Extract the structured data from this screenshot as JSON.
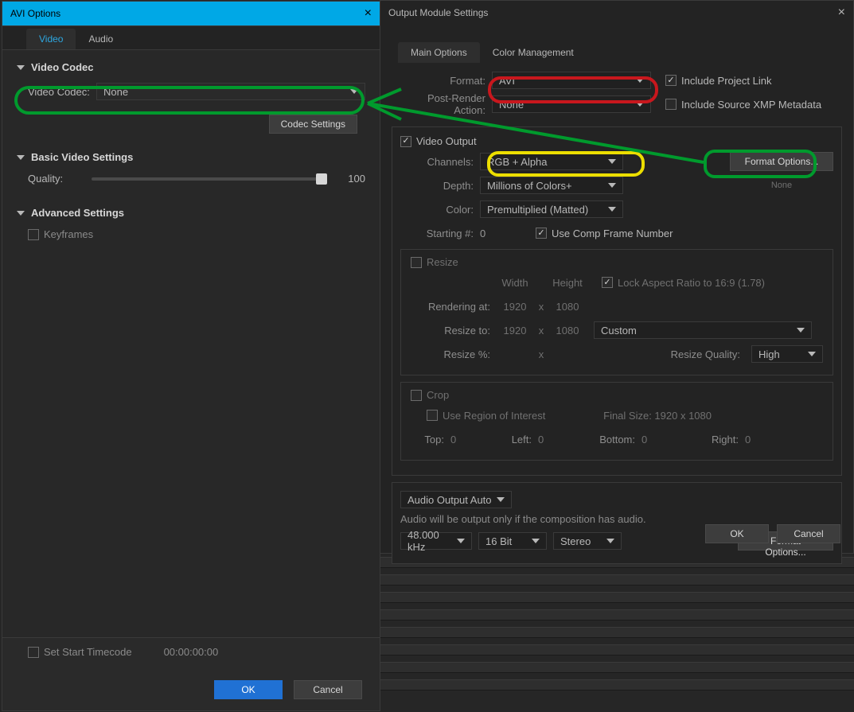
{
  "avi": {
    "title": "AVI Options",
    "tabs": {
      "video": "Video",
      "audio": "Audio"
    },
    "video_codec_header": "Video Codec",
    "video_codec_label": "Video Codec:",
    "video_codec_value": "None",
    "codec_settings_btn": "Codec Settings",
    "basic_header": "Basic Video Settings",
    "quality_label": "Quality:",
    "quality_value": "100",
    "advanced_header": "Advanced Settings",
    "keyframes_label": "Keyframes",
    "set_start_tc_label": "Set Start Timecode",
    "timecode_value": "00:00:00:00",
    "ok": "OK",
    "cancel": "Cancel"
  },
  "oms": {
    "title": "Output Module Settings",
    "tabs": {
      "main": "Main Options",
      "color": "Color Management"
    },
    "format_label": "Format:",
    "format_value": "AVI",
    "post_render_label": "Post-Render Action:",
    "post_render_value": "None",
    "include_project_link": "Include Project Link",
    "include_xmp": "Include Source XMP Metadata",
    "video_output_label": "Video Output",
    "channels_label": "Channels:",
    "channels_value": "RGB + Alpha",
    "format_options_btn": "Format Options...",
    "depth_label": "Depth:",
    "depth_value": "Millions of Colors+",
    "depth_note": "None",
    "color_label": "Color:",
    "color_value": "Premultiplied (Matted)",
    "starting_label": "Starting #:",
    "starting_value": "0",
    "use_comp_frame": "Use Comp Frame Number",
    "resize": {
      "header": "Resize",
      "width": "Width",
      "height": "Height",
      "lock_aspect": "Lock Aspect Ratio to 16:9 (1.78)",
      "rendering_at_label": "Rendering at:",
      "rendering_w": "1920",
      "rendering_h": "1080",
      "x": "x",
      "resize_to_label": "Resize to:",
      "resize_w": "1920",
      "resize_h": "1080",
      "preset": "Custom",
      "resize_pct_label": "Resize %:",
      "quality_label": "Resize Quality:",
      "quality_value": "High"
    },
    "crop": {
      "header": "Crop",
      "use_roi": "Use Region of Interest",
      "final_size": "Final Size: 1920 x 1080",
      "top": "Top:",
      "top_v": "0",
      "left": "Left:",
      "left_v": "0",
      "bottom": "Bottom:",
      "bottom_v": "0",
      "right": "Right:",
      "right_v": "0"
    },
    "audio": {
      "header": "Audio Output Auto",
      "note": "Audio will be output only if the composition has audio.",
      "rate": "48.000 kHz",
      "depth": "16 Bit",
      "channels": "Stereo",
      "format_options": "Format Options..."
    },
    "ok": "OK",
    "cancel": "Cancel"
  }
}
